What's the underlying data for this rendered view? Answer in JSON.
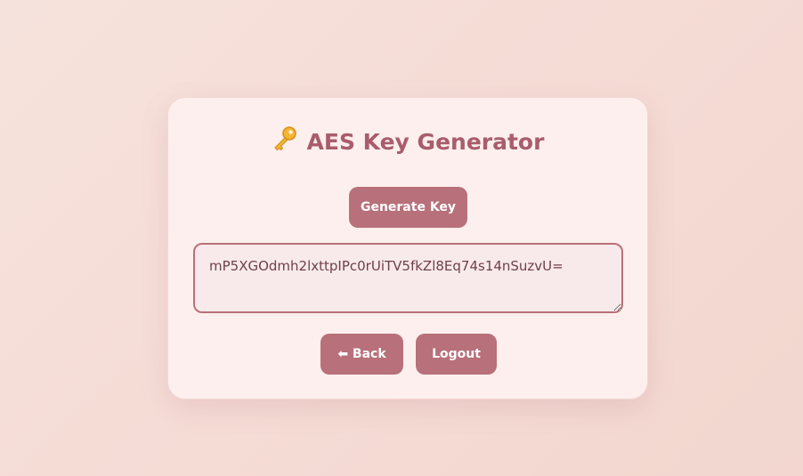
{
  "page": {
    "title": "AES Key Generator",
    "title_icon": "key-icon",
    "generate_button_label": "Generate Key",
    "generated_key": "mP5XGOdmh2lxttpIPc0rUiTV5fkZl8Eq74s14nSuzvU=",
    "back_button_label": "⬅ Back",
    "logout_button_label": "Logout"
  },
  "colors": {
    "accent": "#b8707a",
    "title": "#a95d6c",
    "card_background": "#fdefed",
    "page_background": "#f5dcd5"
  }
}
